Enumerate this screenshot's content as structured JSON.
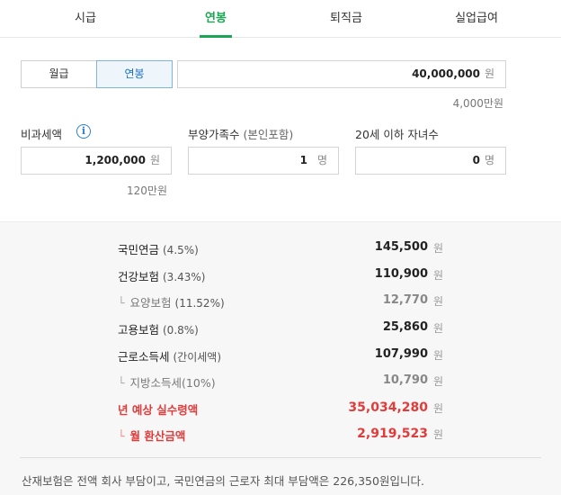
{
  "tabs": [
    "시급",
    "연봉",
    "퇴직금",
    "실업급여"
  ],
  "active_tab": "연봉",
  "accent_color": "#1aa653",
  "segment": {
    "monthly": "월급",
    "annual": "연봉"
  },
  "salary": {
    "value": "40,000,000",
    "unit": "원",
    "hint": "4,000만원"
  },
  "nontax": {
    "label": "비과세액",
    "value": "1,200,000",
    "unit": "원",
    "hint": "120만원",
    "info_icon": "i"
  },
  "dependents": {
    "label": "부양가족수",
    "label_sub": "(본인포함)",
    "value": "1",
    "unit": "명"
  },
  "children": {
    "label": "20세 이하 자녀수",
    "value": "0",
    "unit": "명"
  },
  "results": [
    {
      "name": "국민연금",
      "pct": "(4.5%)",
      "amount": "145,500",
      "unit": "원"
    },
    {
      "name": "건강보험",
      "pct": "(3.43%)",
      "amount": "110,900",
      "unit": "원"
    },
    {
      "name": "요양보험",
      "pct": "(11.52%)",
      "amount": "12,770",
      "unit": "원"
    },
    {
      "name": "고용보험",
      "pct": "(0.8%)",
      "amount": "25,860",
      "unit": "원"
    },
    {
      "name": "근로소득세",
      "pct": "(간이세액)",
      "amount": "107,990",
      "unit": "원"
    },
    {
      "name": "지방소득세(10%)",
      "pct": "",
      "amount": "10,790",
      "unit": "원"
    },
    {
      "name": "년 예상 실수령액",
      "pct": "",
      "amount": "35,034,280",
      "unit": "원"
    },
    {
      "name": "월 환산금액",
      "pct": "",
      "amount": "2,919,523",
      "unit": "원"
    }
  ],
  "tick": "└",
  "note": "산재보험은 전액 회사 부담이고, 국민연금의 근로자 최대 부담액은 226,350원입니다."
}
